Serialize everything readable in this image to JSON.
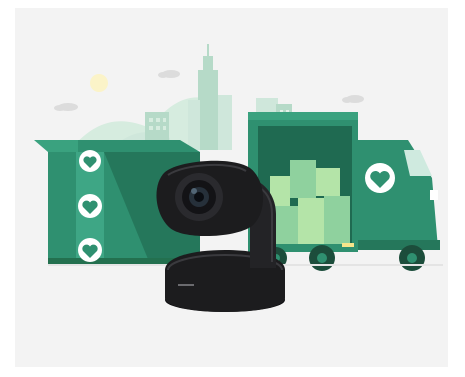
{
  "image": {
    "camera_brand_text": "logitech"
  },
  "colors": {
    "panel_bg": "#f3f3f3",
    "skyline": "#cfe7db",
    "skyline_dark": "#b6dac8",
    "box_green": "#2f9070",
    "box_green_dark": "#25775b",
    "truck_green": "#2f9070",
    "truck_dark": "#1f6a51",
    "cargo_light": "#8fd19e",
    "cargo_lighter": "#b4e4a8",
    "heart_badge_bg": "#ffffff",
    "camera_body": "#1c1c1e",
    "camera_highlight": "#3a3a3e",
    "sun": "#fbf3c8"
  },
  "icons": [
    "heart-badge-icon",
    "sun-icon",
    "cloud-icon"
  ]
}
